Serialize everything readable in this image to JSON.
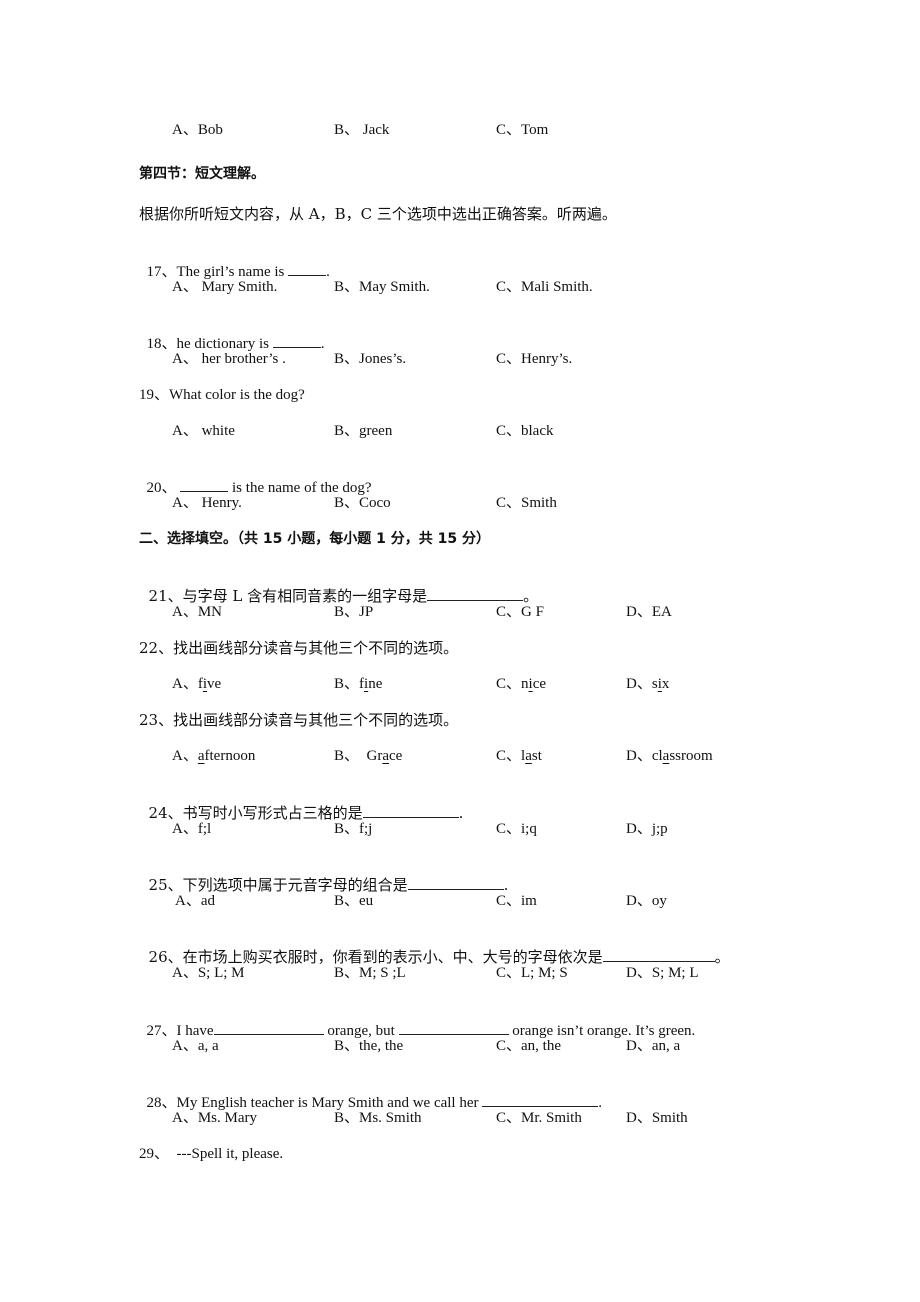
{
  "prev_question_options": {
    "a": "A、Bob",
    "b": "B、 Jack",
    "c": "C、Tom"
  },
  "section4": {
    "heading": "第四节：短文理解。",
    "instruction": "根据你所听短文内容，从 A，B，C 三个选项中选出正确答案。听两遍。"
  },
  "q17": {
    "stem": "17、The girl’s name is ",
    "tail": ".",
    "a": "A、 Mary Smith.",
    "b": "B、May Smith.",
    "c": "C、Mali Smith."
  },
  "q18": {
    "stem": "18、he dictionary is ",
    "tail": ".",
    "a": "A、 her brother’s .",
    "b": "B、Jones’s.",
    "c": "C、Henry’s."
  },
  "q19": {
    "stem": "19、What color is the dog?",
    "a": "A、 white",
    "b": "B、green",
    "c": "C、black"
  },
  "q20": {
    "num": "20、 ",
    "tail": " is the name of the dog?",
    "a": "A、 Henry.",
    "b": "B、Coco",
    "c": "C、Smith"
  },
  "part2": {
    "heading": "二、选择填空。（共 15 小题，每小题 1 分，共 15 分）"
  },
  "q21": {
    "stem": "21、与字母 L 含有相同音素的一组字母是",
    "tail": "。",
    "a": "A、MN",
    "b": "B、JP",
    "c": "C、G F",
    "d": "D、EA"
  },
  "q22": {
    "stem": "22、找出画线部分读音与其他三个不同的选项。",
    "options": [
      {
        "label": "A、",
        "pre": "f",
        "underlined": "i",
        "post": "ve"
      },
      {
        "label": "B、",
        "pre": "f",
        "underlined": "i",
        "post": "ne"
      },
      {
        "label": "C、",
        "pre": "n",
        "underlined": "i",
        "post": "ce"
      },
      {
        "label": "D、",
        "pre": "s",
        "underlined": "i",
        "post": "x"
      }
    ]
  },
  "q23": {
    "stem": "23、找出画线部分读音与其他三个不同的选项。",
    "options": [
      {
        "label": "A、",
        "pre": "",
        "underlined": "a",
        "post": "fternoon"
      },
      {
        "label": "B、  ",
        "pre": "Gr",
        "underlined": "a",
        "post": "ce"
      },
      {
        "label": "C、",
        "pre": "l",
        "underlined": "a",
        "post": "st"
      },
      {
        "label": "D、",
        "pre": "cl",
        "underlined": "a",
        "post": "ssroom"
      }
    ]
  },
  "q24": {
    "stem": "24、书写时小写形式占三格的是",
    "tail": ".",
    "a": "A、f;l",
    "b": "B、f;j",
    "c": "C、i;q",
    "d": "D、j;p"
  },
  "q25": {
    "stem": "25、下列选项中属于元音字母的组合是",
    "tail": ".",
    "a": "A、ad",
    "b": "B、eu",
    "c": "C、im",
    "d": "D、oy"
  },
  "q26": {
    "stem": "26、在市场上购买衣服时，你看到的表示小、中、大号的字母依次是",
    "tail": "。",
    "a": "A、S; L; M",
    "b": "B、M; S ;L",
    "c": "C、L; M; S",
    "d": "D、S; M; L"
  },
  "q27": {
    "part1": "27、I have",
    "part2": " orange, but ",
    "part3": " orange isn’t orange. It’s green.",
    "a": "A、a, a",
    "b": "B、the, the",
    "c": "C、an, the",
    "d": "D、an, a"
  },
  "q28": {
    "stem": "28、My English teacher is Mary Smith and we call her ",
    "tail": ".",
    "a": "A、Ms. Mary",
    "b": "B、Ms. Smith",
    "c": "C、Mr. Smith",
    "d": "D、Smith"
  },
  "q29": {
    "stem": "29、  ---Spell it, please."
  }
}
